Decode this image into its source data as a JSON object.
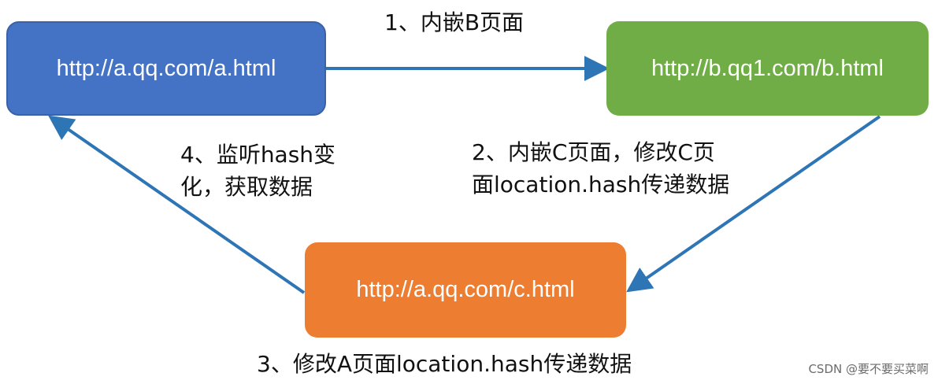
{
  "diagram": {
    "nodes": {
      "a": {
        "text": "http://a.qq.com/a.html",
        "color": "#4472c4"
      },
      "b": {
        "text": "http://b.qq1.com/b.html",
        "color": "#70ad47"
      },
      "c": {
        "text": "http://a.qq.com/c.html",
        "color": "#ed7d31"
      }
    },
    "arrow_color": "#2e75b6",
    "edges": [
      {
        "from": "a",
        "to": "b"
      },
      {
        "from": "b",
        "to": "c"
      },
      {
        "from": "c",
        "to": "a"
      }
    ],
    "labels": {
      "step1": "1、内嵌B页面",
      "step2": [
        "2、内嵌C页面，修改C页",
        "面location.hash传递数据"
      ],
      "step3": "3、修改A页面location.hash传递数据",
      "step4": [
        "4、监听hash变",
        "化，获取数据"
      ]
    }
  },
  "watermark": "CSDN @要不要买菜啊"
}
